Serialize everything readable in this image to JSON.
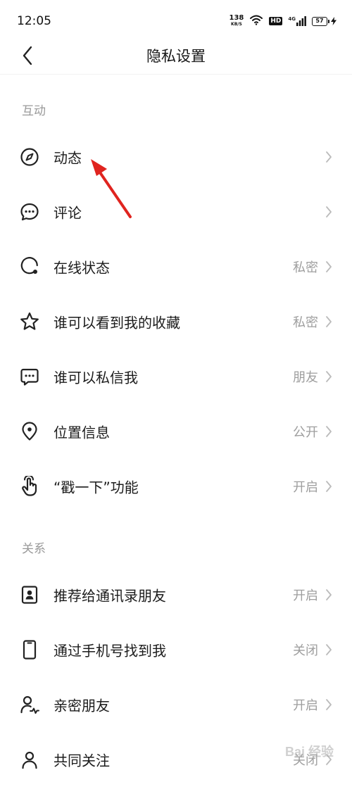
{
  "status_bar": {
    "time": "12:05",
    "net_speed": "138",
    "net_unit": "KB/S",
    "hd": "HD",
    "net_type": "4G",
    "battery": "57"
  },
  "header": {
    "title": "隐私设置"
  },
  "sections": {
    "interaction": "互动",
    "relations": "关系"
  },
  "rows": [
    {
      "label": "动态",
      "value": "",
      "icon": "compass-icon"
    },
    {
      "label": "评论",
      "value": "",
      "icon": "comment-icon"
    },
    {
      "label": "在线状态",
      "value": "私密",
      "icon": "online-status-icon"
    },
    {
      "label": "谁可以看到我的收藏",
      "value": "私密",
      "icon": "star-icon"
    },
    {
      "label": "谁可以私信我",
      "value": "朋友",
      "icon": "message-icon"
    },
    {
      "label": "位置信息",
      "value": "公开",
      "icon": "location-pin-icon"
    },
    {
      "label": "“戳一下”功能",
      "value": "开启",
      "icon": "poke-hand-icon"
    },
    {
      "label": "推荐给通讯录朋友",
      "value": "开启",
      "icon": "contact-card-icon"
    },
    {
      "label": "通过手机号找到我",
      "value": "关闭",
      "icon": "phone-icon"
    },
    {
      "label": "亲密朋友",
      "value": "开启",
      "icon": "close-friend-icon"
    },
    {
      "label": "共同关注",
      "value": "关闭",
      "icon": "user-icon"
    }
  ],
  "annotation_color": "#e0241f",
  "watermark": "Bai 经验"
}
